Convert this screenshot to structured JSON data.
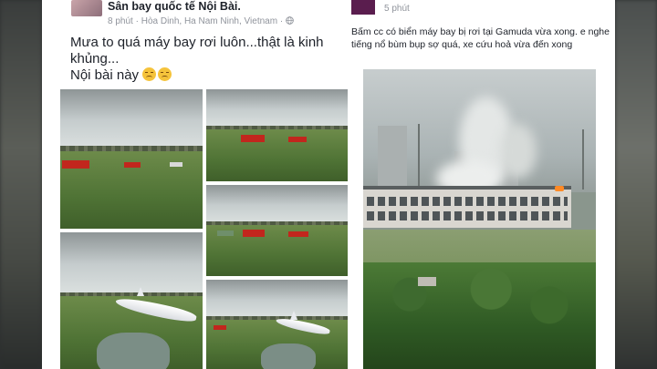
{
  "left_post": {
    "page_name": "Sân bay quốc tế Nội Bài.",
    "time": "8 phút",
    "location": "Hòa Dinh, Ha Nam Ninh, Vietnam",
    "separator": "·",
    "privacy_icon": "globe-icon",
    "text_line1": "Mưa to quá máy bay rơi luôn...thật là kinh khủng...",
    "text_line2": "Nội bài này",
    "emoji": [
      "disappointed-face-icon",
      "disappointed-face-icon"
    ]
  },
  "right_post": {
    "time": "5 phút",
    "text": "Bấm cc có biển máy bay bị rơi tại Gamuda vừa xong. e nghe tiếng nổ bùm bụp sợ quá, xe cứu hoả vừa đến xong"
  },
  "colors": {
    "background": "#2c2f30",
    "post_background": "#ffffff",
    "meta_text": "#90949c",
    "body_text": "#1d2129",
    "fire_truck": "#c2261d"
  }
}
